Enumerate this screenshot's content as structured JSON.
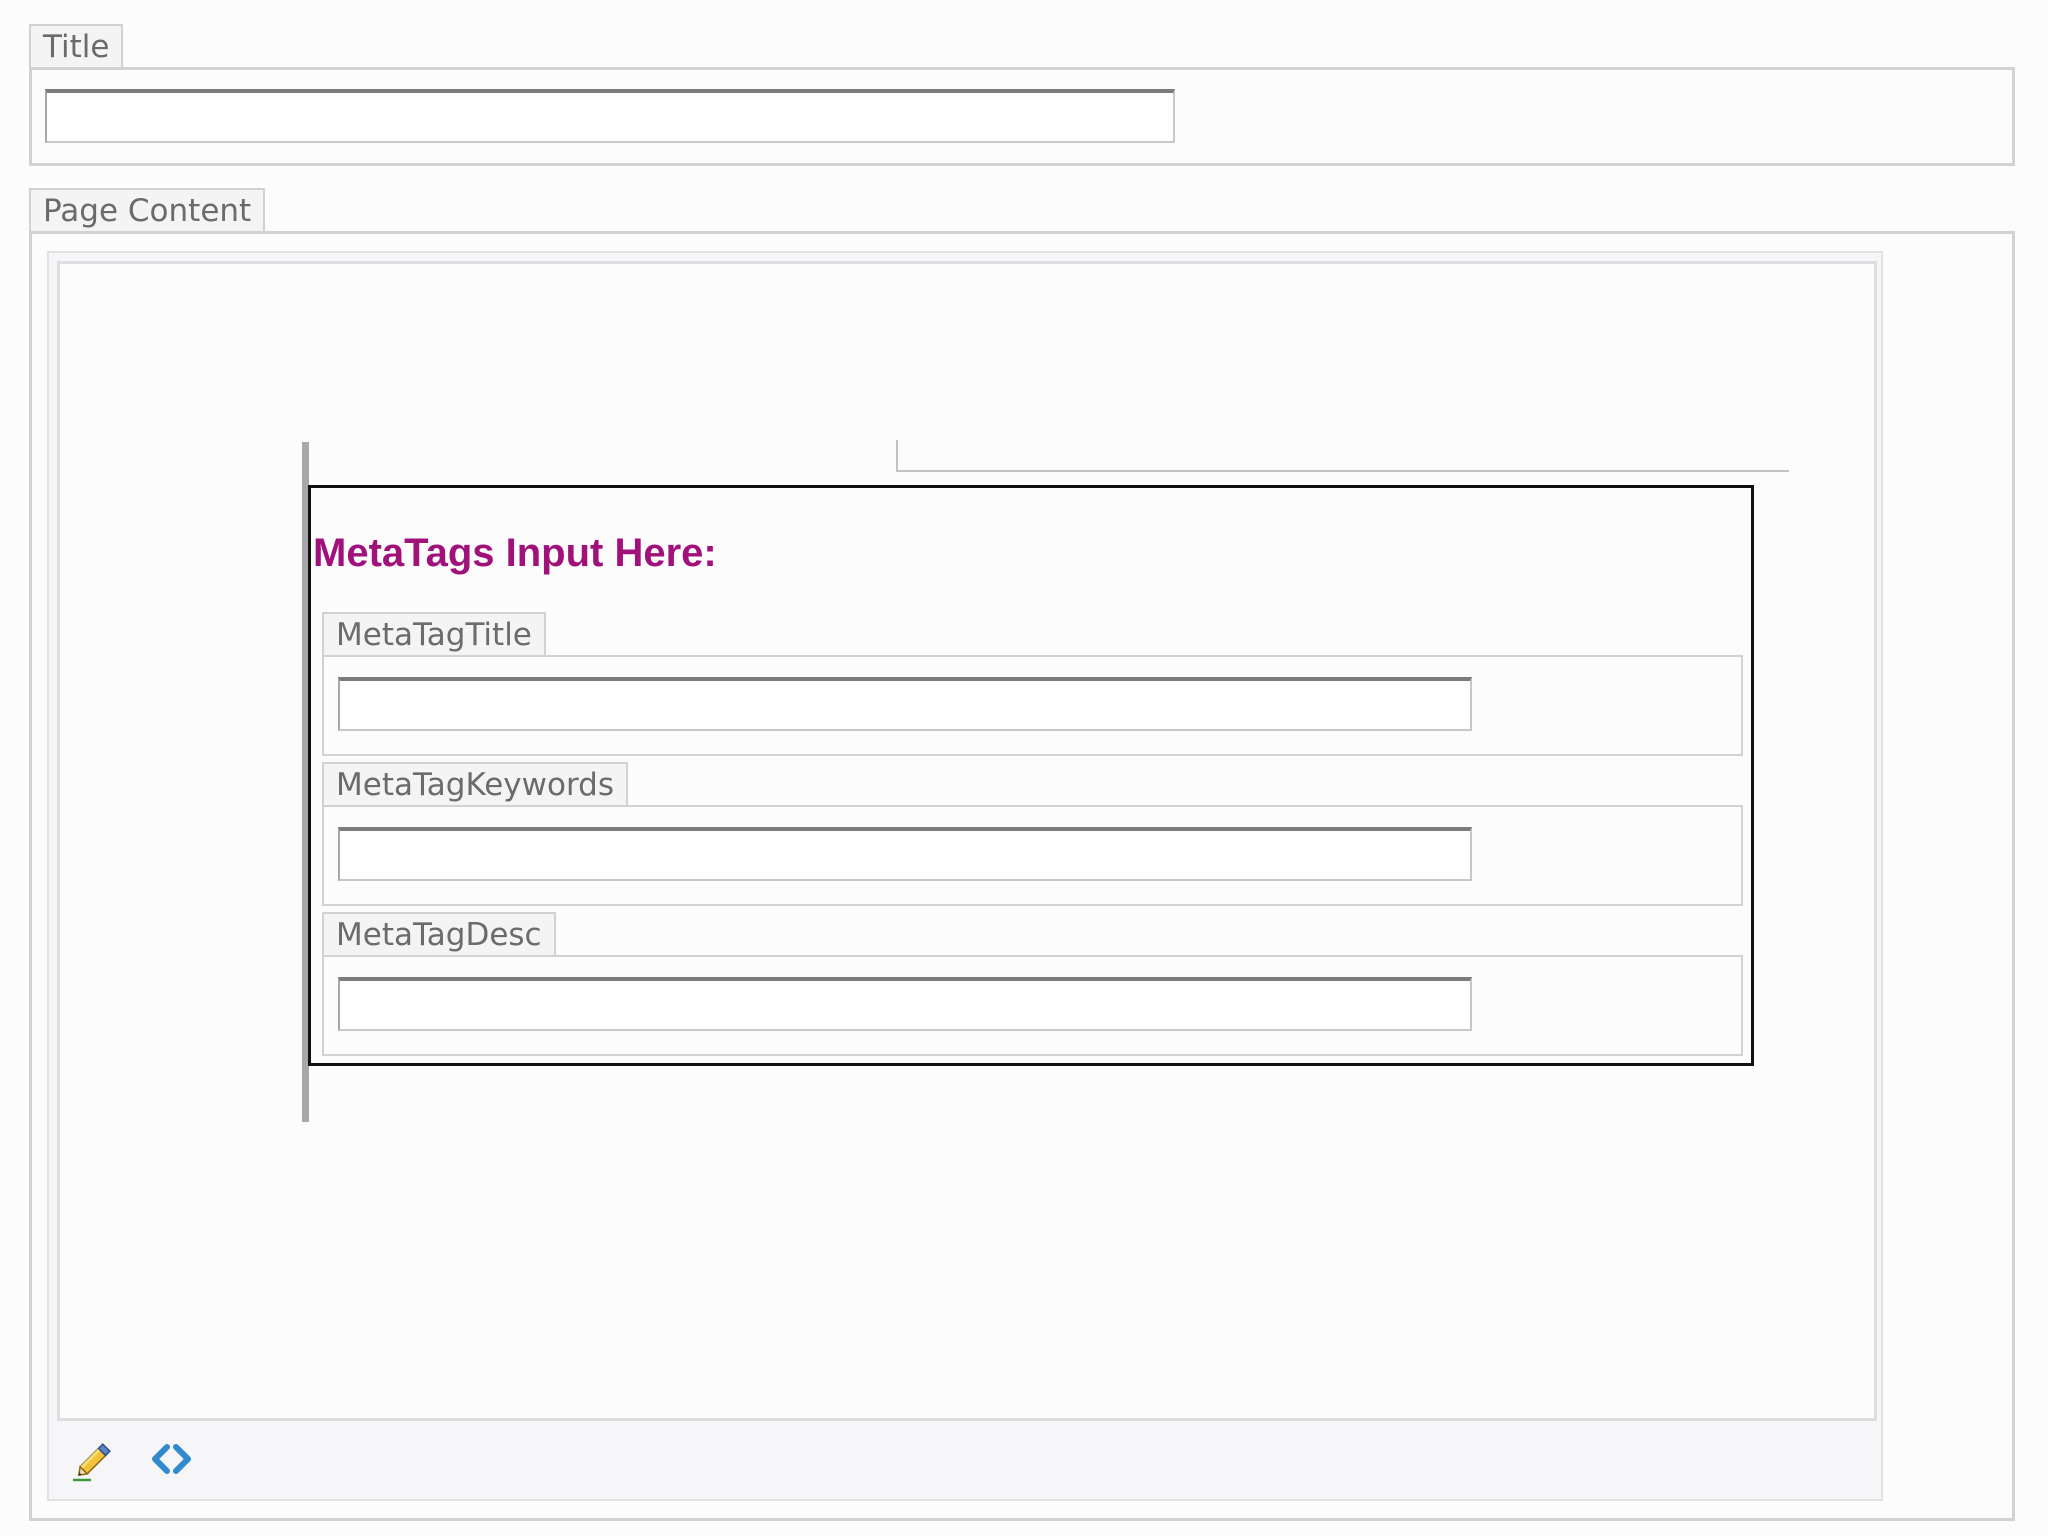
{
  "title_field": {
    "label": "Title",
    "value": "",
    "placeholder": ""
  },
  "page_content": {
    "label": "Page Content",
    "snippet": {
      "heading": "MetaTags Input Here:",
      "heading_color": "#a0117a",
      "fields": [
        {
          "label": "MetaTagTitle",
          "value": ""
        },
        {
          "label": "MetaTagKeywords",
          "value": ""
        },
        {
          "label": "MetaTagDesc",
          "value": ""
        }
      ]
    },
    "toolbar": {
      "items": [
        {
          "icon": "pencil-icon",
          "mode": "design"
        },
        {
          "icon": "html-code-icon",
          "mode": "html"
        }
      ]
    }
  },
  "colors": {
    "border": "#d4d1d4",
    "label_text": "#6b6b6b",
    "heading": "#a0117a",
    "code_icon": "#2f8ad0"
  }
}
